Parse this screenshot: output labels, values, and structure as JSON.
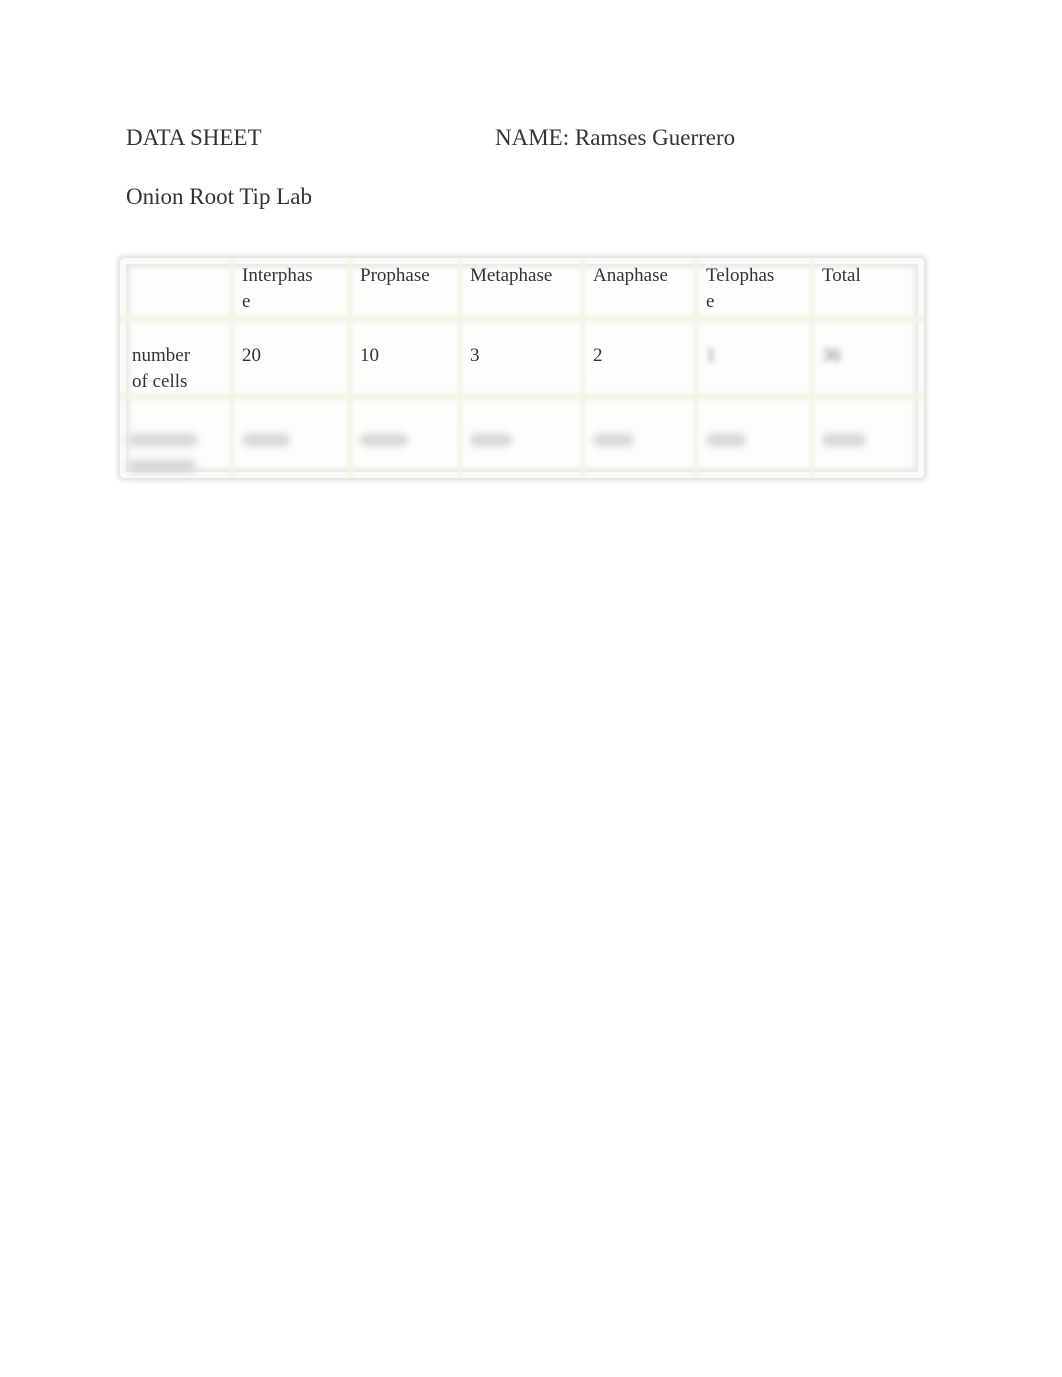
{
  "document": {
    "title": "DATA SHEET",
    "name_line": "NAME: Ramses Guerrero",
    "subtitle": "Onion Root Tip Lab"
  },
  "table": {
    "columns": [
      "",
      "Interphase",
      "Prophase",
      "Metaphase",
      "Anaphase",
      "Telophase",
      "Total"
    ],
    "column_display": [
      "",
      "Interphas\ne",
      "Prophase",
      "Metaphase",
      "Anaphase",
      "Telophas\ne",
      "Total"
    ],
    "rows": [
      {
        "label": "number of cells",
        "label_display": "number\nof cells",
        "values": [
          "20",
          "10",
          "3",
          "2",
          "1",
          "36"
        ],
        "blurred": [
          false,
          false,
          false,
          false,
          true,
          true
        ]
      },
      {
        "label": "percent of cells",
        "label_display": "percent\nof cells",
        "values": [
          "",
          "",
          "",
          "",
          "",
          ""
        ],
        "blurred": [
          true,
          true,
          true,
          true,
          true,
          true
        ]
      }
    ]
  }
}
